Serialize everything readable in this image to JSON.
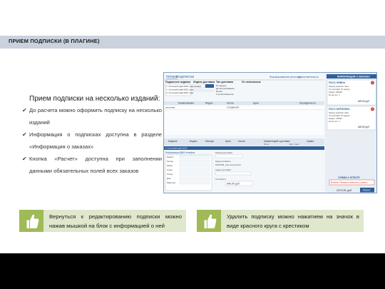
{
  "slide": {
    "title": "ПРИЕМ ПОДПИСКИ (В ПЛАГИНЕ)",
    "lead": "Прием подписки на несколько изданий:",
    "bullets": [
      "До расчета можно оформить подписку на несколько изданий",
      "Информация о подписках доступна в разделе «Информация о заказах»",
      "Кнопка «Расчет» доступна при заполнении данными обязательных полей всех заказов"
    ],
    "tips": [
      "Вернуться к редактированию подписки можно нажав мышкой на блок с информацией о ней",
      "Удалить подписку можно нажатием на значок в виде красного круга с крестиком"
    ]
  },
  "app": {
    "tabs": [
      "ПРИЕМ",
      "ПОДПИСКИ"
    ],
    "top_links": [
      "Формирование реестра",
      "Дополнительно"
    ],
    "form_headers": [
      "Подписное издание",
      "Индекс доставки",
      "Тип доставки",
      "От почтальона"
    ],
    "publication_options": [
      "1. Сельский край 2015 года",
      "2. Сельский край 2015 года",
      "3. Сельский край 2015 года"
    ],
    "delivery_index": "344000",
    "delivery_types": [
      "По адресу",
      "До востребования",
      "На а/я",
      "1 на а/я абонента"
    ],
    "grid1_headers": [
      "Наименование",
      "Индекс",
      "Кол-во",
      "Цена",
      "Периодичность"
    ],
    "grid1_row_left": "регионам",
    "grid1_row_value": "0 ИЗДАНИЯ",
    "grid2_headers": [
      "Издание",
      "Индекс",
      "Месяцы",
      "Цена",
      "Кол-во",
      "Комментарий к доставке",
      "Сумма"
    ],
    "grid2_sub_headers": [
      "Итого",
      "Доп. пакет"
    ],
    "grid2_row": "1 Сельский край 2015",
    "address_label": "Информация ДМИ-телефон",
    "address_fields": [
      "Индекс",
      "Регион",
      "Район",
      "Город",
      "Улица",
      "Дом",
      "Квартира"
    ],
    "pay_labels": [
      "Период доставки",
      "Куда доставить",
      "ПАРКОВ, для получателя",
      "Адрес доставки",
      "Стоимость"
    ],
    "total_value": "840,00 руб",
    "order_panel": {
      "title": "ИНФОРМАЦИЯ О ЗАКАЗАХ",
      "orders": [
        {
          "name": "ПОСС ЛИВНА",
          "lines": [
            "Период подписки: 3мес",
            "Тип доставки: По адресу",
            "Индекс: 344000",
            "Кол-во экз.: 1"
          ],
          "sum": "840,00 руб"
        },
        {
          "name": "ПОСС МУРЗИЛКА",
          "lines": [
            "Период подписки: 3мес",
            "Тип доставки: По адресу",
            "Индекс: 344000",
            "Кол-во экз.: 1"
          ],
          "sum": "840,00 руб"
        }
      ],
      "sum_label": "СУММА К ОПЛАТЕ",
      "notice": "Внимание! Проверьте правильность данных",
      "total": "2472,81 руб",
      "calc_button": "Расчет"
    }
  },
  "colors": {
    "title_bar": "#c9d2dd",
    "accent_green": "#9fba57",
    "tip_background": "#dfe7cc",
    "header_blue": "#2f5f9a",
    "delete_red": "#c4271f"
  }
}
